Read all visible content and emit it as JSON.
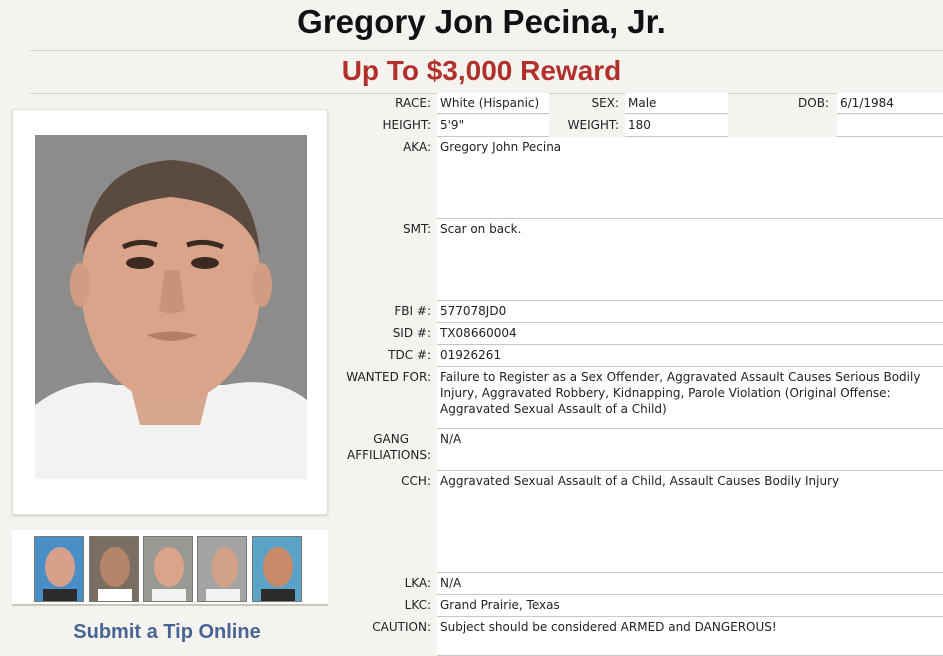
{
  "header": {
    "name": "Gregory Jon Pecina, Jr.",
    "reward": "Up To $3,000 Reward"
  },
  "colors": {
    "reward_red": "#b1302b",
    "link_blue": "#4a6593",
    "page_bg": "#f4f3ef"
  },
  "photo": {
    "icon": "mugshot-photo"
  },
  "thumbnails": [
    {
      "icon": "thumbnail-photo-1"
    },
    {
      "icon": "thumbnail-photo-2"
    },
    {
      "icon": "thumbnail-photo-3"
    },
    {
      "icon": "thumbnail-photo-4"
    },
    {
      "icon": "thumbnail-photo-5"
    }
  ],
  "tip_link": "Submit a Tip Online",
  "details": {
    "race_label": "RACE:",
    "race": "White (Hispanic)",
    "sex_label": "SEX:",
    "sex": "Male",
    "dob_label": "DOB:",
    "dob": "6/1/1984",
    "height_label": "HEIGHT:",
    "height": "5'9\"",
    "weight_label": "WEIGHT:",
    "weight": "180",
    "aka_label": "AKA:",
    "aka": "Gregory John Pecina",
    "smt_label": "SMT:",
    "smt": "Scar on back.",
    "fbi_label": "FBI #:",
    "fbi": "577078JD0",
    "sid_label": "SID #:",
    "sid": "TX08660004",
    "tdc_label": "TDC #:",
    "tdc": "01926261",
    "wanted_label": "WANTED FOR:",
    "wanted": "Failure to Register as a Sex Offender, Aggravated Assault Causes Serious Bodily Injury, Aggravated Robbery, Kidnapping, Parole Violation (Original Offense: Aggravated Sexual Assault of a Child)",
    "gang_label_1": "GANG",
    "gang_label_2": "AFFILIATIONS:",
    "gang": "N/A",
    "cch_label": "CCH:",
    "cch": "Aggravated Sexual Assault of a Child, Assault Causes Bodily Injury",
    "lka_label": "LKA:",
    "lka": "N/A",
    "lkc_label": "LKC:",
    "lkc": "Grand Prairie, Texas",
    "caution_label": "CAUTION:",
    "caution": "Subject should be considered ARMED and DANGEROUS!"
  }
}
